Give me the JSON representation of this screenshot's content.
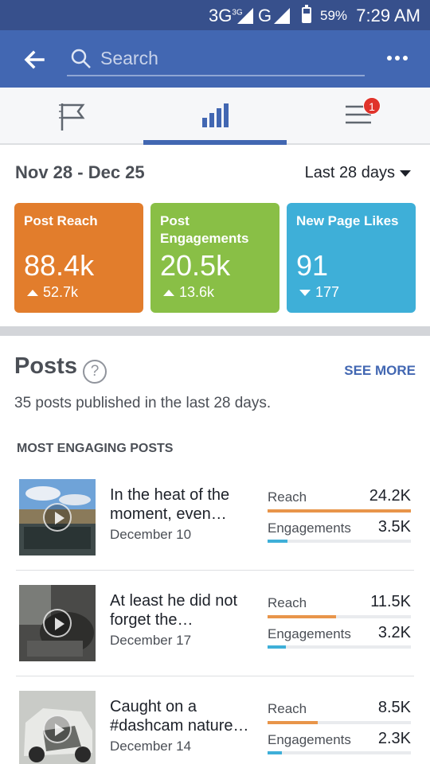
{
  "status_bar": {
    "network": "3G",
    "network_sup": "3G",
    "signal2": "G",
    "battery": "59%",
    "time": "7:29 AM"
  },
  "search": {
    "placeholder": "Search"
  },
  "tabs": [
    {
      "name": "page",
      "icon": "flag-icon"
    },
    {
      "name": "insights",
      "icon": "bar-chart-icon",
      "active": true
    },
    {
      "name": "menu",
      "icon": "menu-icon",
      "badge": "1"
    }
  ],
  "date_range": "Nov 28 - Dec 25",
  "period": "Last 28 days",
  "stats": [
    {
      "label": "Post Reach",
      "value": "88.4k",
      "delta": "52.7k",
      "direction": "up",
      "color": "#e27d2c"
    },
    {
      "label": "Post Engagements",
      "value": "20.5k",
      "delta": "13.6k",
      "direction": "up",
      "color": "#89bf46"
    },
    {
      "label": "New Page Likes",
      "value": "91",
      "delta": "177",
      "direction": "down",
      "color": "#3eafd8"
    }
  ],
  "posts": {
    "title": "Posts",
    "see_more": "SEE MORE",
    "summary": "35 posts published in the last 28 days.",
    "most_engaging_header": "MOST ENGAGING POSTS",
    "reach_label": "Reach",
    "engagements_label": "Engagements",
    "items": [
      {
        "text": "In the heat of the moment, even…",
        "date": "December 10",
        "reach": "24.2K",
        "engagements": "3.5K",
        "reach_fraction": 1.0,
        "engagements_fraction": 0.14
      },
      {
        "text": "At least he did not forget the…",
        "date": "December 17",
        "reach": "11.5K",
        "engagements": "3.2K",
        "reach_fraction": 0.48,
        "engagements_fraction": 0.13
      },
      {
        "text": "Caught on a #dashcam nature…",
        "date": "December 14",
        "reach": "8.5K",
        "engagements": "2.3K",
        "reach_fraction": 0.35,
        "engagements_fraction": 0.1
      }
    ]
  },
  "colors": {
    "header": "#4267b2",
    "status": "#37508c",
    "reach_bar": "#e8954a",
    "engagement_bar": "#3eafd8"
  }
}
